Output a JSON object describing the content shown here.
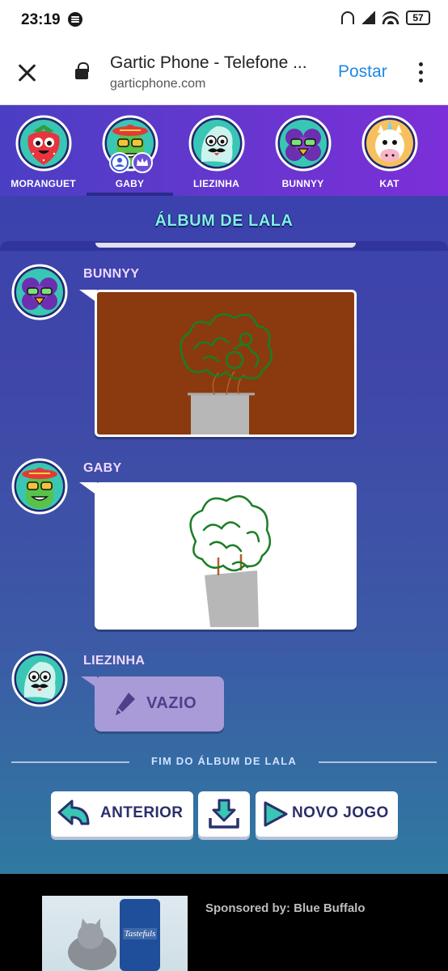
{
  "status_bar": {
    "time": "23:19",
    "battery": "57"
  },
  "browser": {
    "title": "Gartic Phone - Telefone ...",
    "url": "garticphone.com",
    "action": "Postar"
  },
  "players": [
    {
      "name": "MORANGUET",
      "avatar": "strawberry-avatar"
    },
    {
      "name": "GABY",
      "avatar": "cactus-sombrero-avatar",
      "badges": [
        "user-icon",
        "crown-icon"
      ]
    },
    {
      "name": "LIEZINHA",
      "avatar": "ghost-mustache-avatar"
    },
    {
      "name": "BUNNYY",
      "avatar": "purple-flower-avatar"
    },
    {
      "name": "KAT",
      "avatar": "unicorn-avatar"
    }
  ],
  "album": {
    "title": "ÁLBUM DE LALA",
    "entries": [
      {
        "player": "BUNNYY",
        "type": "drawing",
        "background": "#8a3a0e"
      },
      {
        "player": "GABY",
        "type": "drawing",
        "background": "#ffffff"
      },
      {
        "player": "LIEZINHA",
        "type": "empty",
        "label": "VAZIO"
      }
    ],
    "end_text": "FIM DO ÁLBUM DE LALA"
  },
  "buttons": {
    "previous": "ANTERIOR",
    "new_game": "NOVO JOGO"
  },
  "ad": {
    "sponsor": "Sponsored by: Blue Buffalo",
    "product": "Tastefuls"
  },
  "colors": {
    "accent_teal": "#39c6b5",
    "title_cyan": "#7ff0e6",
    "button_text": "#2b2f6b"
  }
}
